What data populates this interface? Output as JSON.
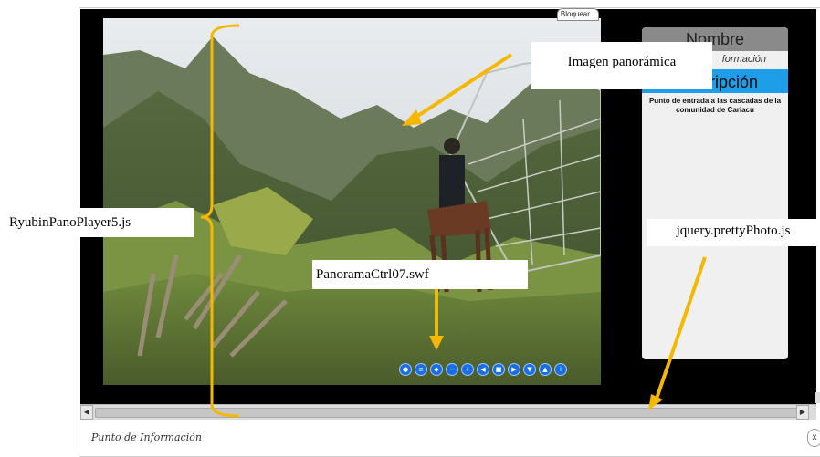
{
  "window": {
    "lock_label": "Bloquear..."
  },
  "info_panel": {
    "name_header": "Nombre",
    "info_line": "formación",
    "description_header": "Descripción",
    "description_text": "Punto de entrada a las cascadas de la comunidad de Cariacu"
  },
  "controls": {
    "buttons": [
      "pin",
      "menu",
      "hotspot",
      "zoom-out",
      "zoom-in",
      "left",
      "stop",
      "right",
      "down",
      "up",
      "info"
    ],
    "glyphs": [
      "●",
      "≡",
      "◆",
      "−",
      "+",
      "◀",
      "■",
      "▶",
      "▼",
      "▲",
      "i"
    ]
  },
  "footer": {
    "title": "Punto de Información",
    "close_label": "x"
  },
  "annotations": {
    "panoramic_image": "Imagen panorámica",
    "ryubin_player": "RyubinPanoPlayer5.js",
    "jquery_pretty": "jquery.prettyPhoto.js",
    "panorama_ctrl": "PanoramaCtrl07.swf"
  },
  "colors": {
    "annotation_arrow": "#f5b800",
    "description_header": "#1e9de8",
    "control_button": "#1a6fe0"
  }
}
